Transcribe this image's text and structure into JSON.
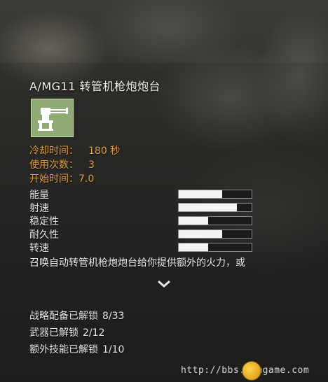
{
  "item": {
    "title": "A/MG11 转管机枪炮炮台",
    "icon": "turret-icon",
    "cooldown_label": "冷却时间：",
    "cooldown_value": "180 秒",
    "uses_label": "使用次数：",
    "uses_value": "3",
    "start_label": "开始时间：",
    "start_value": "7.0"
  },
  "stats": [
    {
      "label": "能量",
      "level": 0.6
    },
    {
      "label": "射速",
      "level": 0.8
    },
    {
      "label": "稳定性",
      "level": 0.4
    },
    {
      "label": "耐久性",
      "level": 0.6
    },
    {
      "label": "转速",
      "level": 0.4
    }
  ],
  "description": {
    "line1": "召唤自动转管机枪炮炮台给你提供额外的火力，或"
  },
  "unlocks": {
    "strategy_label": "战略配备已解锁",
    "strategy_value": "8/33",
    "weapons_label": "武器已解锁",
    "weapons_value": "2/12",
    "skills_label": "额外技能已解锁",
    "skills_value": "1/10"
  },
  "watermark": {
    "url": "http://bbs.3dmgame.com"
  },
  "colors": {
    "accent_orange": "#e6a23a",
    "icon_bg": "#8faa72",
    "bar_fill": "#f4f4f4"
  }
}
